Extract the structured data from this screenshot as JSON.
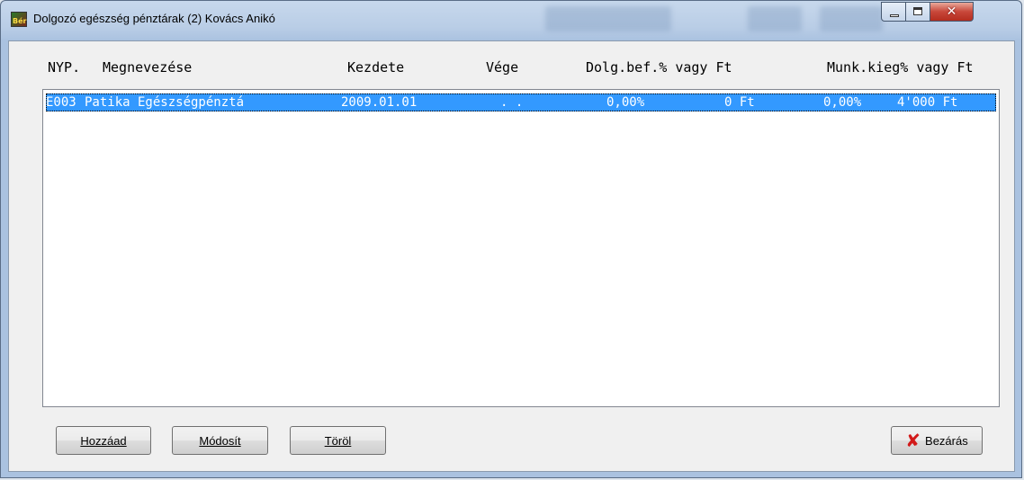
{
  "window": {
    "title": "Dolgozó egészség pénztárak (2) Kovács Anikó",
    "icon": "app-icon",
    "icon_text": "Bér"
  },
  "columns": {
    "nyp": "NYP.",
    "name": "Megnevezése",
    "start": "Kezdete",
    "end": "Vége",
    "employee_contrib": "Dolg.bef.% vagy Ft",
    "employer_supplement": "Munk.kieg% vagy Ft"
  },
  "rows": [
    {
      "code": "E003",
      "name": "Patika Egészségpénztá",
      "start": "2009.01.01",
      "end": ". .",
      "emp_pct": "0,00%",
      "emp_ft": "0 Ft",
      "emr_pct": "0,00%",
      "emr_ft": "4'000 Ft",
      "selected": true
    }
  ],
  "buttons": {
    "add": "Hozzáad",
    "edit": "Módosít",
    "delete": "Töröl",
    "close": "Bezárás"
  },
  "colors": {
    "selection": "#3399ff",
    "close_icon": "#d21a1a"
  }
}
